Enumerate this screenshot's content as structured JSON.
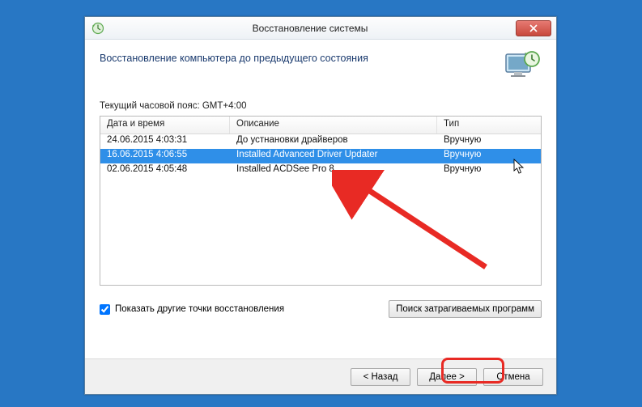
{
  "titlebar": {
    "title": "Восстановление системы"
  },
  "header": {
    "text": "Восстановление компьютера до предыдущего состояния"
  },
  "timezone_label": "Текущий часовой пояс: GMT+4:00",
  "table": {
    "headers": {
      "date": "Дата и время",
      "desc": "Описание",
      "type": "Тип"
    },
    "rows": [
      {
        "date": "24.06.2015 4:03:31",
        "desc": "До устнановки драйверов",
        "type": "Вручную",
        "selected": false
      },
      {
        "date": "16.06.2015 4:06:55",
        "desc": "Installed Advanced Driver Updater",
        "type": "Вручную",
        "selected": true
      },
      {
        "date": "02.06.2015 4:05:48",
        "desc": "Installed ACDSee Pro 8",
        "type": "Вручную",
        "selected": false
      }
    ]
  },
  "checkbox": {
    "label": "Показать другие точки восстановления",
    "checked": true
  },
  "buttons": {
    "scan": "Поиск затрагиваемых программ",
    "back": "< Назад",
    "next": "Далее >",
    "cancel": "Отмена"
  }
}
